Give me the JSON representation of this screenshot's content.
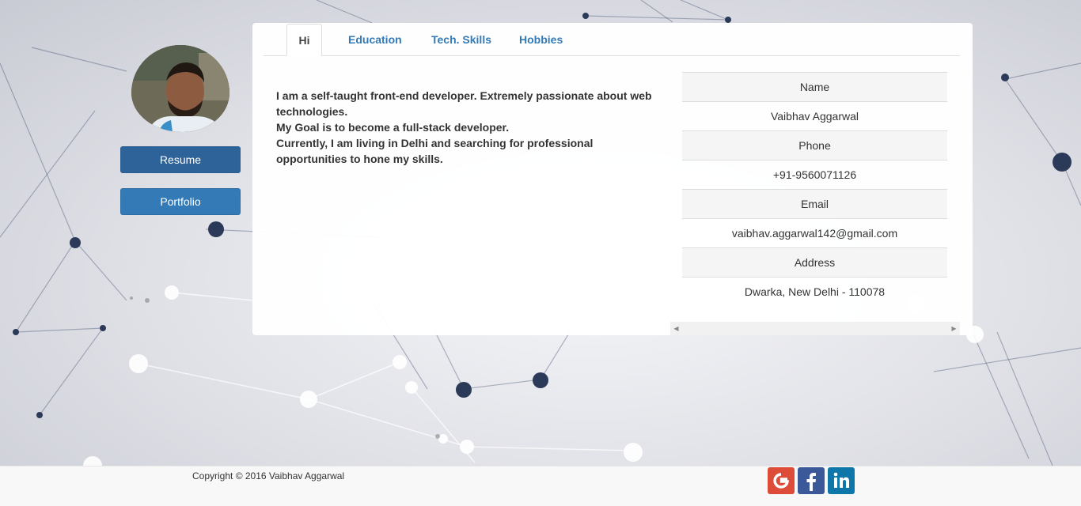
{
  "sidebar": {
    "resume_label": "Resume",
    "portfolio_label": "Portfolio"
  },
  "tabs": [
    {
      "label": "Hi",
      "active": true
    },
    {
      "label": "Education",
      "active": false
    },
    {
      "label": "Tech. Skills",
      "active": false
    },
    {
      "label": "Hobbies",
      "active": false
    }
  ],
  "intro": {
    "line1": "I am a self-taught front-end developer. Extremely passionate about web technologies.",
    "line2": "My Goal is to become a full-stack developer.",
    "line3": "Currently, I am living in Delhi and searching for professional opportunities to hone my skills."
  },
  "info": {
    "name_label": "Name",
    "name_value": "Vaibhav Aggarwal",
    "phone_label": "Phone",
    "phone_value": "+91-9560071126",
    "email_label": "Email",
    "email_value": "vaibhav.aggarwal142@gmail.com",
    "address_label": "Address",
    "address_value": "Dwarka, New Delhi - 110078"
  },
  "footer": {
    "copyright": "Copyright © 2016 Vaibhav Aggarwal",
    "social": [
      {
        "icon": "google-icon",
        "color": "#dd4b39"
      },
      {
        "icon": "facebook-icon",
        "color": "#3b5998"
      },
      {
        "icon": "linkedin-icon",
        "color": "#0e76a8"
      }
    ]
  },
  "colors": {
    "primary": "#337ab7",
    "primary_dark": "#2d6399"
  }
}
